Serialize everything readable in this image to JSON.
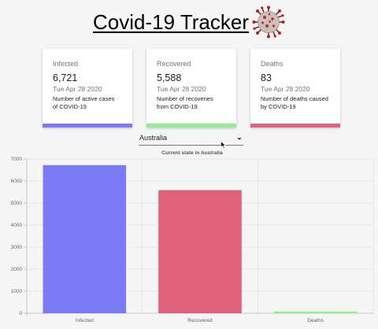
{
  "app": {
    "title": "Covid-19 Tracker"
  },
  "cards": [
    {
      "label": "Infected",
      "value": "6,721",
      "date": "Tue Apr 28 2020",
      "desc_line1": "Number of active cases",
      "desc_line2": "of COVID-19",
      "color": "#7b7bf6"
    },
    {
      "label": "Recovered",
      "value": "5,588",
      "date": "Tue Apr 28 2020",
      "desc_line1": "Number of recoveries",
      "desc_line2": "from COVID-19",
      "color": "#90f090"
    },
    {
      "label": "Deaths",
      "value": "83",
      "date": "Tue Apr 28 2020",
      "desc_line1": "Number of deaths caused",
      "desc_line2": "by COVID-19",
      "color": "#e0627a"
    }
  ],
  "country_select": {
    "value": "Australia"
  },
  "chart_data": {
    "type": "bar",
    "title": "Current state in Australia",
    "categories": [
      "Infected",
      "Recovered",
      "Deaths"
    ],
    "values": [
      6721,
      5588,
      83
    ],
    "colors": [
      "#7b7bf6",
      "#e0627a",
      "#90f090"
    ],
    "ylim": [
      0,
      7000
    ],
    "yticks": [
      "0",
      "1000",
      "2000",
      "3000",
      "4000",
      "5000",
      "6000",
      "7000"
    ],
    "grid": true,
    "xlabel": "",
    "ylabel": ""
  }
}
